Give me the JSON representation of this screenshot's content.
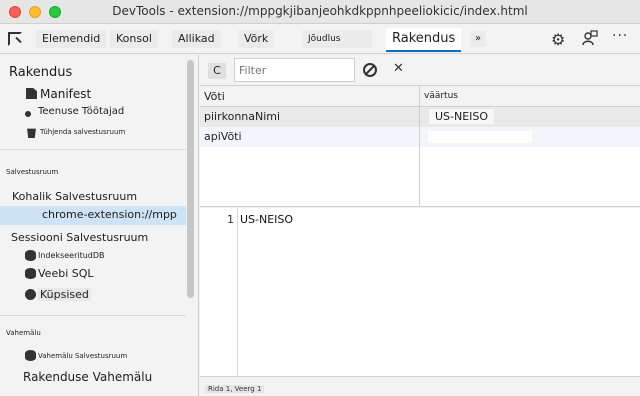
{
  "window": {
    "title": "DevTools - extension://mppgkjibanjeohkdkppnhpeeliokicic/index.html"
  },
  "tabs": [
    {
      "label": "Elemendid"
    },
    {
      "label": "Konsol"
    },
    {
      "label": "Allikad"
    },
    {
      "label": "Võrk"
    },
    {
      "label": "Jõudlus"
    },
    {
      "label": "Rakendus"
    }
  ],
  "more_tabs_label": "»",
  "sidebar": {
    "app_heading": "Rakendus",
    "app_items": [
      {
        "label": "Manifest",
        "icon": "document-icon"
      },
      {
        "label": "Teenuse Töötajad",
        "icon": "gear-icon"
      },
      {
        "label": "Tühjenda salvestusruum",
        "icon": "trash-icon"
      }
    ],
    "storage_heading": "Salvestusruum",
    "local_storage": "Kohalik Salvestusruum",
    "local_storage_item": "chrome-extension://mpp",
    "session_storage": "Sessiooni Salvestusruum",
    "storage_items": [
      {
        "label": "IndekseeritudDB",
        "icon": "database-icon"
      },
      {
        "label": "Veebi SQL",
        "icon": "database-icon"
      },
      {
        "label": "Küpsised",
        "icon": "cookie-icon"
      }
    ],
    "cache_heading": "Vahemälu",
    "cache_items": [
      {
        "label": "Vahemälu Salvestusruum",
        "icon": "database-icon"
      },
      {
        "label": "Rakenduse Vahemälu",
        "icon": "database-icon"
      }
    ]
  },
  "toolbar": {
    "refresh_label": "C",
    "filter_placeholder": "Filter",
    "delete_label": "✕"
  },
  "table": {
    "columns": [
      "Võti",
      "väärtus"
    ],
    "rows": [
      {
        "key": "piirkonnaNimi",
        "value": "US-NEISO"
      },
      {
        "key": "apiVõti",
        "value": ""
      }
    ]
  },
  "preview": {
    "line_number": "1",
    "text": "US-NEISO"
  },
  "status": {
    "text": "Rida 1, Veerg 1"
  }
}
